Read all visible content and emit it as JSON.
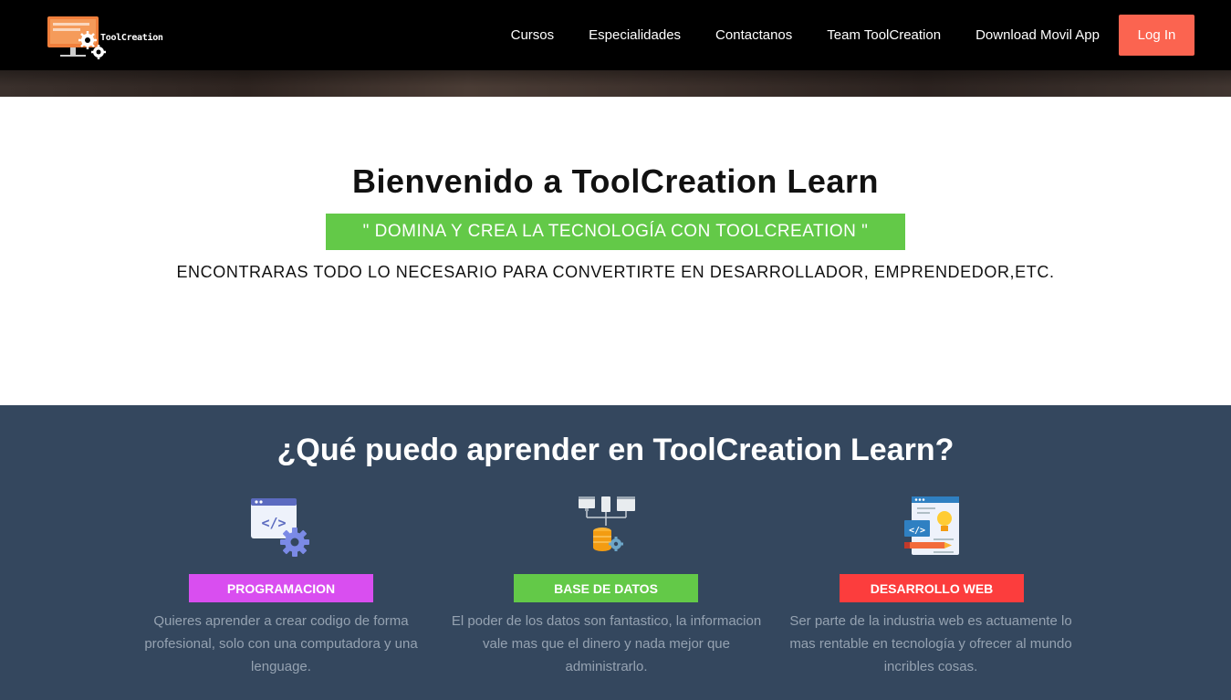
{
  "brand": {
    "logo_text": "ToolCreation",
    "accent": "#fb6450"
  },
  "nav": {
    "links": [
      "Cursos",
      "Especialidades",
      "Contactanos",
      "Team ToolCreation",
      "Download Movil App"
    ],
    "login_label": "Log In"
  },
  "welcome": {
    "title": "Bienvenido a ToolCreation Learn",
    "slogan": "\" DOMINA Y CREA LA TECNOLOGÍA CON TOOLCREATION \"",
    "subtitle": "ENCONTRARAS TODO LO NECESARIO PARA CONVERTIRTE EN DESARROLLADOR, EMPRENDEDOR,ETC."
  },
  "features": {
    "title": "¿Qué puedo aprender en ToolCreation Learn?",
    "cards": [
      {
        "label": "PROGRAMACION",
        "color": "#d94ef0",
        "icon": "code-gear-icon",
        "description": "Quieres aprender a crear codigo de forma profesional, solo con una computadora y una lenguage."
      },
      {
        "label": "BASE DE DATOS",
        "color": "#63c948",
        "icon": "database-network-icon",
        "description": "El poder de los datos son fantastico, la informacion vale mas que el dinero y nada mejor que administrarlo."
      },
      {
        "label": "DESARROLLO WEB",
        "color": "#fc3d3d",
        "icon": "web-design-icon",
        "description": "Ser parte de la industria web es actuamente lo mas rentable en tecnología y ofrecer al mundo incribles cosas."
      }
    ]
  }
}
